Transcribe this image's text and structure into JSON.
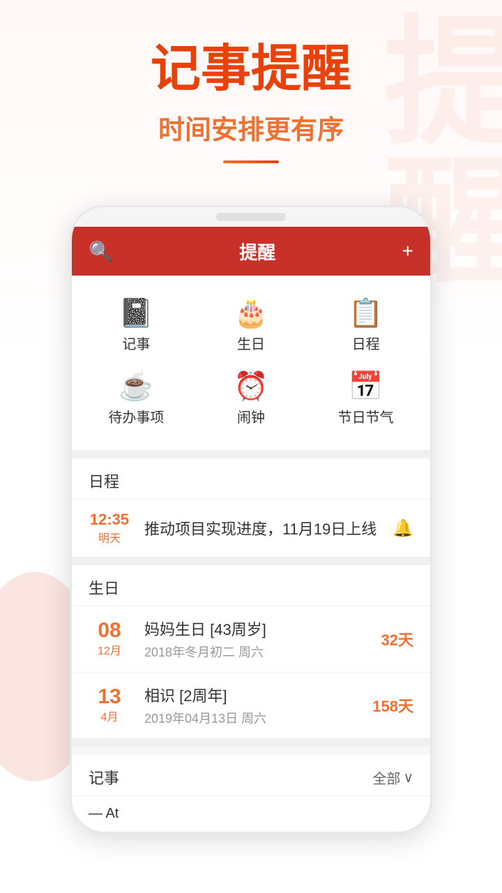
{
  "background": {
    "watermark": "提醒",
    "gradient_start": "#fff8f6",
    "gradient_end": "#ffffff"
  },
  "hero": {
    "title": "记事提醒",
    "subtitle": "时间安排更有序"
  },
  "app": {
    "header": {
      "title": "提醒",
      "search_icon": "🔍",
      "add_icon": "+"
    },
    "icon_grid": [
      {
        "symbol": "📓",
        "label": "记事"
      },
      {
        "symbol": "🎂",
        "label": "生日"
      },
      {
        "symbol": "📋",
        "label": "日程"
      },
      {
        "symbol": "☕",
        "label": "待办事项"
      },
      {
        "symbol": "⏰",
        "label": "闹钟"
      },
      {
        "symbol": "📅",
        "label": "节日节气"
      }
    ],
    "sections": {
      "schedule": {
        "label": "日程",
        "items": [
          {
            "time": "12:35",
            "time_sub": "明天",
            "text": "推动项目实现进度，11月19日上线",
            "has_bell": true
          }
        ]
      },
      "birthday": {
        "label": "生日",
        "items": [
          {
            "day": "08",
            "month": "12月",
            "name": "妈妈生日 [43周岁]",
            "date": "2018年冬月初二 周六",
            "days": "32天"
          },
          {
            "day": "13",
            "month": "4月",
            "name": "相识 [2周年]",
            "date": "2019年04月13日 周六",
            "days": "158天"
          }
        ]
      },
      "notes": {
        "label": "记事",
        "right_label": "全部",
        "chevron": "∨",
        "items": []
      }
    }
  }
}
